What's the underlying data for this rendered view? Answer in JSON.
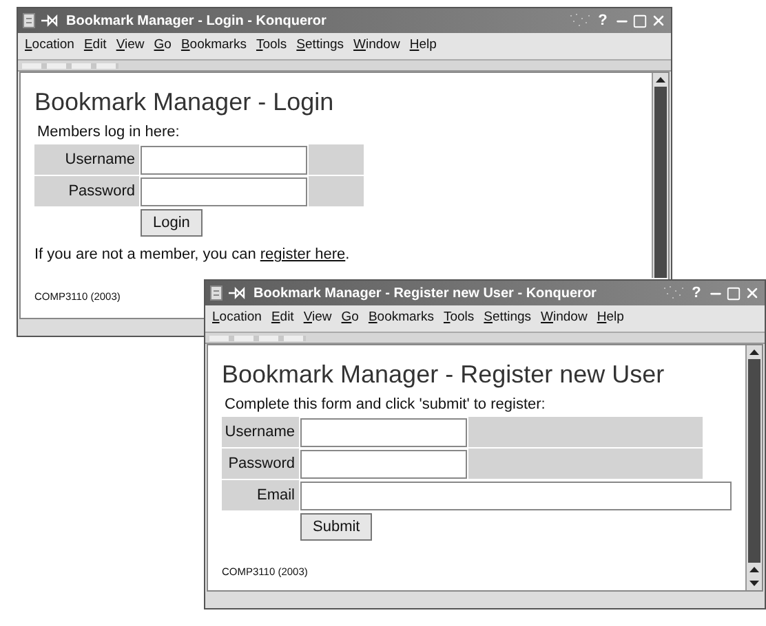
{
  "windows": [
    {
      "title": "Bookmark Manager - Login - Konqueror",
      "help_button": "?",
      "menu": [
        "Location",
        "Edit",
        "View",
        "Go",
        "Bookmarks",
        "Tools",
        "Settings",
        "Window",
        "Help"
      ],
      "page": {
        "heading": "Bookmark Manager - Login",
        "intro": "Members log in here:",
        "fields": [
          {
            "label": "Username",
            "kind": "short"
          },
          {
            "label": "Password",
            "kind": "short"
          }
        ],
        "button": "Login",
        "note": "If you are not a member, you can ",
        "link": "register here",
        "note_end": ".",
        "footer": "COMP3110 (2003)"
      }
    },
    {
      "title": "Bookmark Manager - Register new User - Konqueror",
      "help_button": "?",
      "menu": [
        "Location",
        "Edit",
        "View",
        "Go",
        "Bookmarks",
        "Tools",
        "Settings",
        "Window",
        "Help"
      ],
      "page": {
        "heading": "Bookmark Manager - Register new User",
        "intro": "Complete this form and click 'submit' to register:",
        "fields": [
          {
            "label": "Username",
            "kind": "short"
          },
          {
            "label": "Password",
            "kind": "short"
          },
          {
            "label": "Email",
            "kind": "wide"
          }
        ],
        "button": "Submit",
        "footer": "COMP3110 (2003)"
      }
    }
  ]
}
